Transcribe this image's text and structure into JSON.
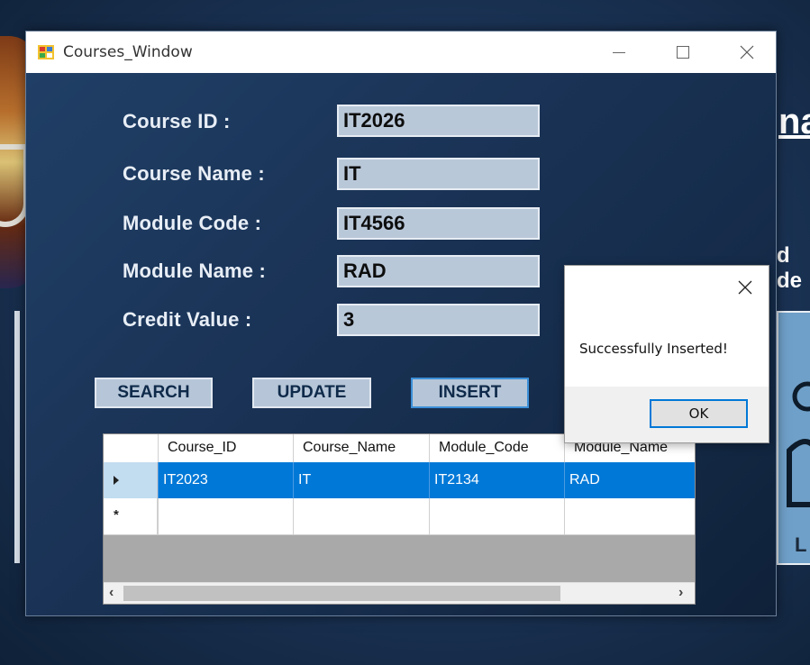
{
  "window": {
    "title": "Courses_Window"
  },
  "form": {
    "fields": [
      {
        "label": "Course ID :",
        "value": "IT2026"
      },
      {
        "label": "Course Name :",
        "value": "IT"
      },
      {
        "label": "Module Code :",
        "value": "IT4566"
      },
      {
        "label": "Module Name :",
        "value": "RAD"
      },
      {
        "label": "Credit Value :",
        "value": "3"
      }
    ]
  },
  "buttons": {
    "search": "SEARCH",
    "update": "UPDATE",
    "insert": "INSERT"
  },
  "grid": {
    "columns": [
      "Course_ID",
      "Course_Name",
      "Module_Code",
      "Module_Name"
    ],
    "rows": [
      [
        "IT2023",
        "IT",
        "IT2134",
        "RAD"
      ]
    ],
    "new_row_marker": "*",
    "selected_row_marker": "▶"
  },
  "dialog": {
    "message": "Successfully Inserted!",
    "ok_label": "OK"
  },
  "background_app": {
    "text_1": "na",
    "text_2": "d de",
    "text_3": "L"
  },
  "colors": {
    "selection": "#0078d7",
    "window_bg": "#1d3a5f",
    "input_bg": "#b9c8d9"
  }
}
